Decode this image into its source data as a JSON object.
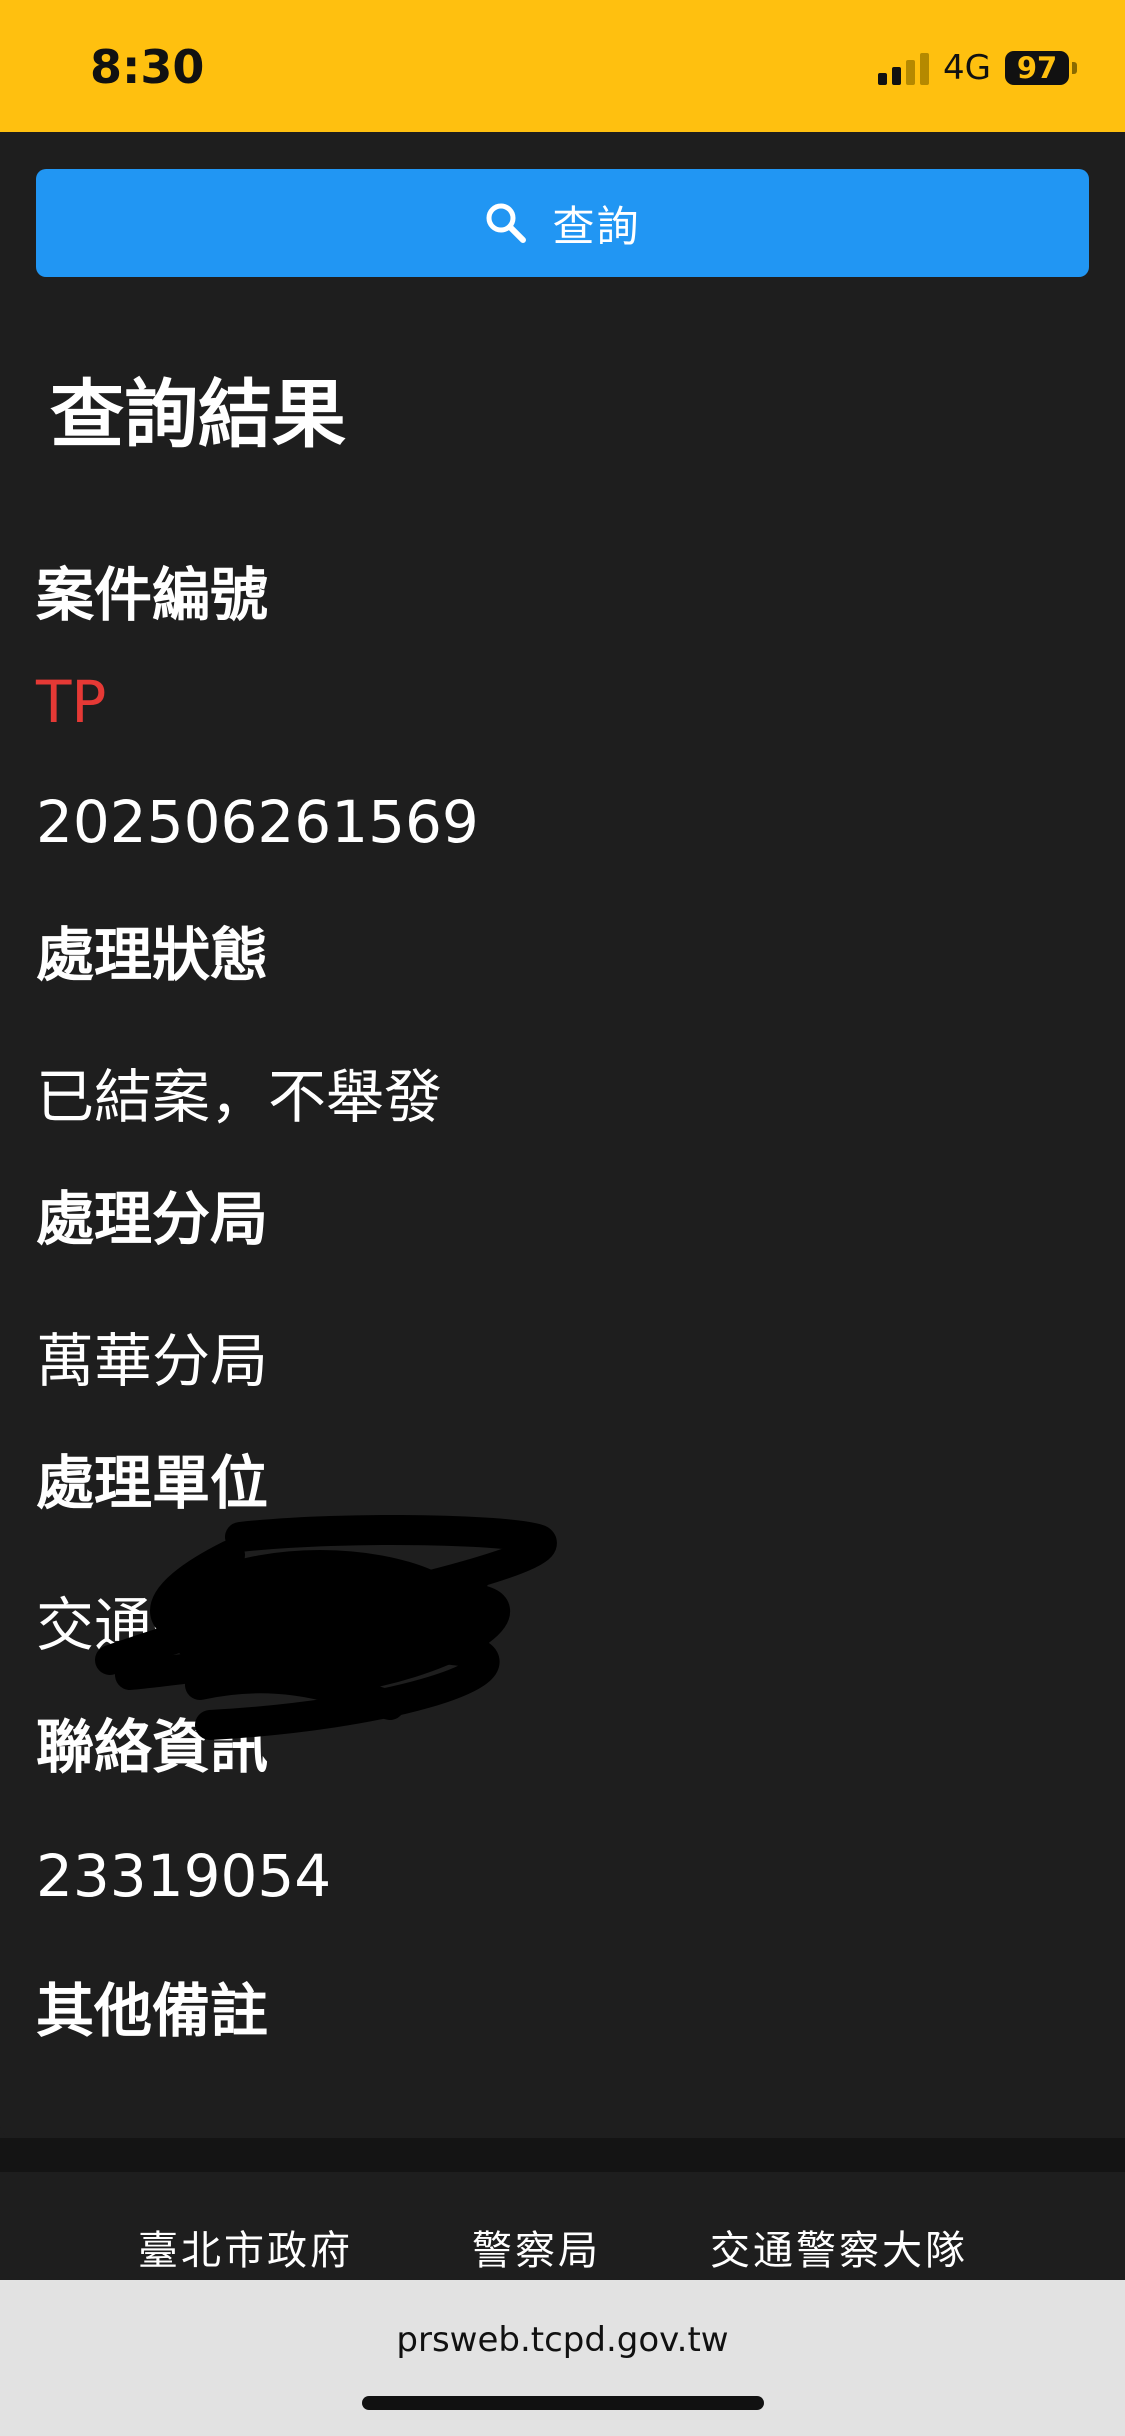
{
  "status_bar": {
    "time": "8:30",
    "network": "4G",
    "battery": "97"
  },
  "search": {
    "button_label": "查詢"
  },
  "result": {
    "title": "查詢結果",
    "fields": [
      {
        "label": "案件編號",
        "value_prefix": "TP",
        "value": "202506261569"
      },
      {
        "label": "處理狀態",
        "value": "已結案，不舉發"
      },
      {
        "label": "處理分局",
        "value": "萬華分局"
      },
      {
        "label": "處理單位",
        "value": "交通組"
      },
      {
        "label": "聯絡資訊",
        "value": "23319054"
      },
      {
        "label": "其他備註",
        "value": ""
      }
    ]
  },
  "footer": {
    "links": [
      "臺北市政府",
      "警察局",
      "交通警察大隊"
    ]
  },
  "browser": {
    "url": "prsweb.tcpd.gov.tw"
  },
  "colors": {
    "status_bar_bg": "#ffc00f",
    "button_bg": "#2196f3",
    "case_prefix": "#e53935",
    "page_bg": "#1e1e1e"
  }
}
